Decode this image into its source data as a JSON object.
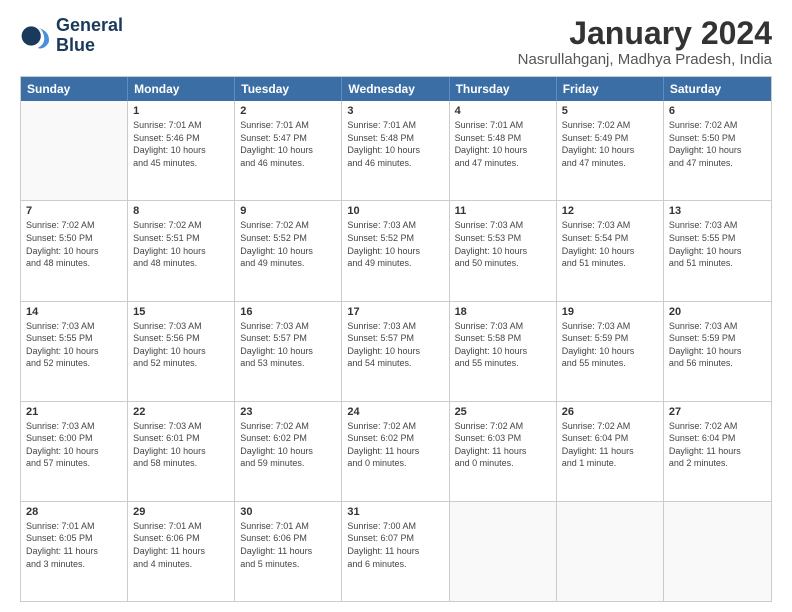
{
  "logo": {
    "line1": "General",
    "line2": "Blue"
  },
  "title": "January 2024",
  "subtitle": "Nasrullahganj, Madhya Pradesh, India",
  "header_days": [
    "Sunday",
    "Monday",
    "Tuesday",
    "Wednesday",
    "Thursday",
    "Friday",
    "Saturday"
  ],
  "rows": [
    [
      {
        "day": "",
        "info": ""
      },
      {
        "day": "1",
        "info": "Sunrise: 7:01 AM\nSunset: 5:46 PM\nDaylight: 10 hours\nand 45 minutes."
      },
      {
        "day": "2",
        "info": "Sunrise: 7:01 AM\nSunset: 5:47 PM\nDaylight: 10 hours\nand 46 minutes."
      },
      {
        "day": "3",
        "info": "Sunrise: 7:01 AM\nSunset: 5:48 PM\nDaylight: 10 hours\nand 46 minutes."
      },
      {
        "day": "4",
        "info": "Sunrise: 7:01 AM\nSunset: 5:48 PM\nDaylight: 10 hours\nand 47 minutes."
      },
      {
        "day": "5",
        "info": "Sunrise: 7:02 AM\nSunset: 5:49 PM\nDaylight: 10 hours\nand 47 minutes."
      },
      {
        "day": "6",
        "info": "Sunrise: 7:02 AM\nSunset: 5:50 PM\nDaylight: 10 hours\nand 47 minutes."
      }
    ],
    [
      {
        "day": "7",
        "info": "Sunrise: 7:02 AM\nSunset: 5:50 PM\nDaylight: 10 hours\nand 48 minutes."
      },
      {
        "day": "8",
        "info": "Sunrise: 7:02 AM\nSunset: 5:51 PM\nDaylight: 10 hours\nand 48 minutes."
      },
      {
        "day": "9",
        "info": "Sunrise: 7:02 AM\nSunset: 5:52 PM\nDaylight: 10 hours\nand 49 minutes."
      },
      {
        "day": "10",
        "info": "Sunrise: 7:03 AM\nSunset: 5:52 PM\nDaylight: 10 hours\nand 49 minutes."
      },
      {
        "day": "11",
        "info": "Sunrise: 7:03 AM\nSunset: 5:53 PM\nDaylight: 10 hours\nand 50 minutes."
      },
      {
        "day": "12",
        "info": "Sunrise: 7:03 AM\nSunset: 5:54 PM\nDaylight: 10 hours\nand 51 minutes."
      },
      {
        "day": "13",
        "info": "Sunrise: 7:03 AM\nSunset: 5:55 PM\nDaylight: 10 hours\nand 51 minutes."
      }
    ],
    [
      {
        "day": "14",
        "info": "Sunrise: 7:03 AM\nSunset: 5:55 PM\nDaylight: 10 hours\nand 52 minutes."
      },
      {
        "day": "15",
        "info": "Sunrise: 7:03 AM\nSunset: 5:56 PM\nDaylight: 10 hours\nand 52 minutes."
      },
      {
        "day": "16",
        "info": "Sunrise: 7:03 AM\nSunset: 5:57 PM\nDaylight: 10 hours\nand 53 minutes."
      },
      {
        "day": "17",
        "info": "Sunrise: 7:03 AM\nSunset: 5:57 PM\nDaylight: 10 hours\nand 54 minutes."
      },
      {
        "day": "18",
        "info": "Sunrise: 7:03 AM\nSunset: 5:58 PM\nDaylight: 10 hours\nand 55 minutes."
      },
      {
        "day": "19",
        "info": "Sunrise: 7:03 AM\nSunset: 5:59 PM\nDaylight: 10 hours\nand 55 minutes."
      },
      {
        "day": "20",
        "info": "Sunrise: 7:03 AM\nSunset: 5:59 PM\nDaylight: 10 hours\nand 56 minutes."
      }
    ],
    [
      {
        "day": "21",
        "info": "Sunrise: 7:03 AM\nSunset: 6:00 PM\nDaylight: 10 hours\nand 57 minutes."
      },
      {
        "day": "22",
        "info": "Sunrise: 7:03 AM\nSunset: 6:01 PM\nDaylight: 10 hours\nand 58 minutes."
      },
      {
        "day": "23",
        "info": "Sunrise: 7:02 AM\nSunset: 6:02 PM\nDaylight: 10 hours\nand 59 minutes."
      },
      {
        "day": "24",
        "info": "Sunrise: 7:02 AM\nSunset: 6:02 PM\nDaylight: 11 hours\nand 0 minutes."
      },
      {
        "day": "25",
        "info": "Sunrise: 7:02 AM\nSunset: 6:03 PM\nDaylight: 11 hours\nand 0 minutes."
      },
      {
        "day": "26",
        "info": "Sunrise: 7:02 AM\nSunset: 6:04 PM\nDaylight: 11 hours\nand 1 minute."
      },
      {
        "day": "27",
        "info": "Sunrise: 7:02 AM\nSunset: 6:04 PM\nDaylight: 11 hours\nand 2 minutes."
      }
    ],
    [
      {
        "day": "28",
        "info": "Sunrise: 7:01 AM\nSunset: 6:05 PM\nDaylight: 11 hours\nand 3 minutes."
      },
      {
        "day": "29",
        "info": "Sunrise: 7:01 AM\nSunset: 6:06 PM\nDaylight: 11 hours\nand 4 minutes."
      },
      {
        "day": "30",
        "info": "Sunrise: 7:01 AM\nSunset: 6:06 PM\nDaylight: 11 hours\nand 5 minutes."
      },
      {
        "day": "31",
        "info": "Sunrise: 7:00 AM\nSunset: 6:07 PM\nDaylight: 11 hours\nand 6 minutes."
      },
      {
        "day": "",
        "info": ""
      },
      {
        "day": "",
        "info": ""
      },
      {
        "day": "",
        "info": ""
      }
    ]
  ]
}
